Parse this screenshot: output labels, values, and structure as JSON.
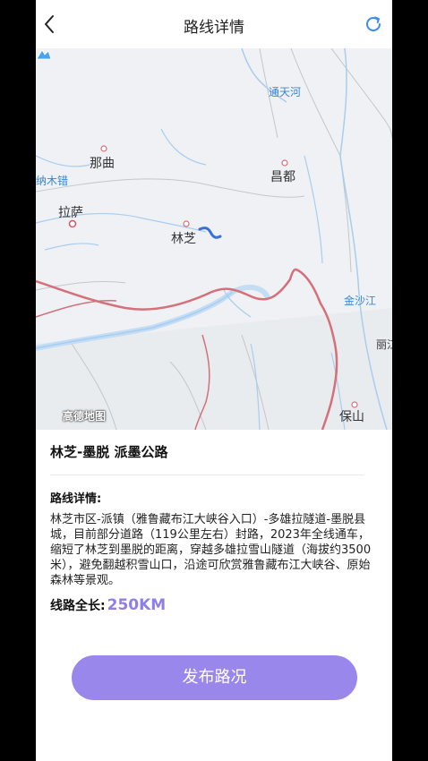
{
  "header": {
    "title": "路线详情",
    "back_icon": "chevron-left-icon",
    "refresh_icon": "refresh-icon"
  },
  "map": {
    "labels": {
      "tongtianhe": "通天河",
      "naqu": "那曲",
      "namucuo": "纳木错",
      "changdu": "昌都",
      "lasa": "拉萨",
      "linzhi": "林芝",
      "jinshajiang": "金沙江",
      "lijiang": "丽江",
      "baoshan": "保山"
    },
    "logo_text": "高德地图",
    "colors": {
      "route": "#3a6fd8",
      "border": "#d5707a",
      "river": "#a8cdf0",
      "land": "#eff1f4"
    }
  },
  "route": {
    "title": "林芝-墨脱 派墨公路",
    "detail_label": "路线详情:",
    "detail_text": "林芝市区-派镇（雅鲁藏布江大峡谷入口）-多雄拉隧道-墨脱县城，目前部分道路（119公里左右）封路，2023年全线通车，缩短了林芝到墨脱的距离，穿越多雄拉雪山隧道（海拔约3500米），避免翻越积雪山口，沿途可欣赏雅鲁藏布江大峡谷、原始森林等景观。",
    "length_label": "线路全长:",
    "length_value": "250KM"
  },
  "actions": {
    "publish_label": "发布路况",
    "accent_color": "#9a87ec"
  }
}
